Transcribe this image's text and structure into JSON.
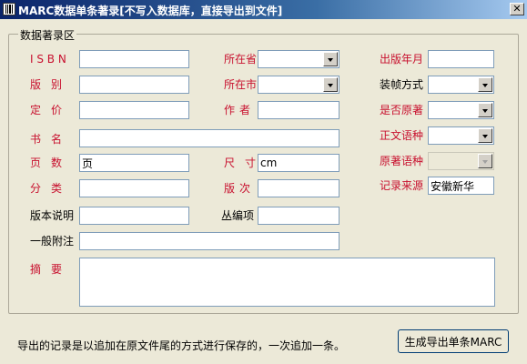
{
  "window": {
    "title": "MARC数据单条著录[不写入数据库，直接导出到文件]",
    "close_glyph": "✕"
  },
  "group": {
    "legend": "数据著录区"
  },
  "fields": {
    "isbn": {
      "label": "I S B N",
      "value": ""
    },
    "edition": {
      "label": "版别",
      "value": ""
    },
    "price": {
      "label": "定价",
      "value": ""
    },
    "title": {
      "label": "书名",
      "value": ""
    },
    "pages": {
      "label": "页数",
      "value": "页"
    },
    "category": {
      "label": "分类",
      "value": ""
    },
    "edition_note": {
      "label": "版本说明",
      "value": ""
    },
    "general_note": {
      "label": "一般附注",
      "value": ""
    },
    "abstract": {
      "label": "摘要",
      "value": ""
    },
    "province": {
      "label": "所在省",
      "value": ""
    },
    "city": {
      "label": "所在市",
      "value": ""
    },
    "author": {
      "label": "作者",
      "value": ""
    },
    "size": {
      "label": "尺寸",
      "value": "cm"
    },
    "print_order": {
      "label": "版次",
      "value": ""
    },
    "series": {
      "label": "丛编项",
      "value": ""
    },
    "pub_date": {
      "label": "出版年月",
      "value": ""
    },
    "binding": {
      "label": "装帧方式",
      "value": ""
    },
    "is_original": {
      "label": "是否原著",
      "value": ""
    },
    "text_lang": {
      "label": "正文语种",
      "value": ""
    },
    "orig_lang": {
      "label": "原著语种",
      "value": ""
    },
    "record_source": {
      "label": "记录来源",
      "value": "安徽新华"
    }
  },
  "footer": {
    "note": "导出的记录是以追加在原文件尾的方式进行保存的，一次追加一条。",
    "generate_button": "生成导出单条MARC"
  }
}
